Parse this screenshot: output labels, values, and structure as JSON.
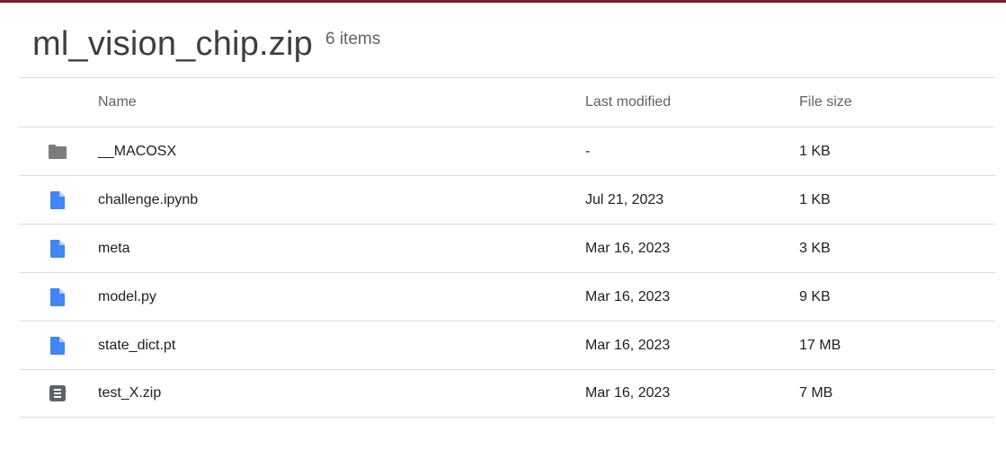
{
  "archive": {
    "title": "ml_vision_chip.zip",
    "item_count": "6 items"
  },
  "columns": {
    "name": "Name",
    "modified": "Last modified",
    "size": "File size"
  },
  "rows": [
    {
      "icon": "folder-icon",
      "name": "__MACOSX",
      "modified": "-",
      "size": "1 KB"
    },
    {
      "icon": "file-icon",
      "name": "challenge.ipynb",
      "modified": "Jul 21, 2023",
      "size": "1 KB"
    },
    {
      "icon": "file-icon",
      "name": "meta",
      "modified": "Mar 16, 2023",
      "size": "3 KB"
    },
    {
      "icon": "file-icon",
      "name": "model.py",
      "modified": "Mar 16, 2023",
      "size": "9 KB"
    },
    {
      "icon": "file-icon",
      "name": "state_dict.pt",
      "modified": "Mar 16, 2023",
      "size": "17 MB"
    },
    {
      "icon": "archive-icon",
      "name": "test_X.zip",
      "modified": "Mar 16, 2023",
      "size": "7 MB"
    }
  ],
  "colors": {
    "accent_bar": "#7a1f2b",
    "folder": "#7d7d7d",
    "file": "#4285f4",
    "archive": "#5f6368"
  }
}
